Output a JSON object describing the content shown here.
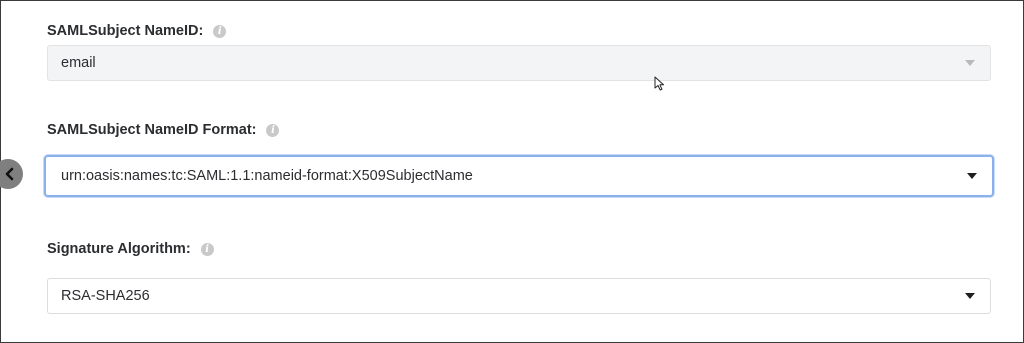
{
  "fields": [
    {
      "label": "SAMLSubject NameID:",
      "value": "email",
      "state": "disabled"
    },
    {
      "label": "SAMLSubject NameID Format:",
      "value": "urn:oasis:names:tc:SAML:1.1:nameid-format:X509SubjectName",
      "state": "focused"
    },
    {
      "label": "Signature Algorithm:",
      "value": "RSA-SHA256",
      "state": "normal"
    }
  ],
  "icons": {
    "info": "info-icon",
    "dropdown": "caret-down-icon",
    "collapse": "chevron-left-icon",
    "cursor": "mouse-pointer-icon"
  },
  "colors": {
    "focus_border": "#8bb1ec",
    "disabled_bg": "#f3f4f5",
    "label_text": "#2b2d30",
    "collapse_button": "#7f7f7f"
  }
}
